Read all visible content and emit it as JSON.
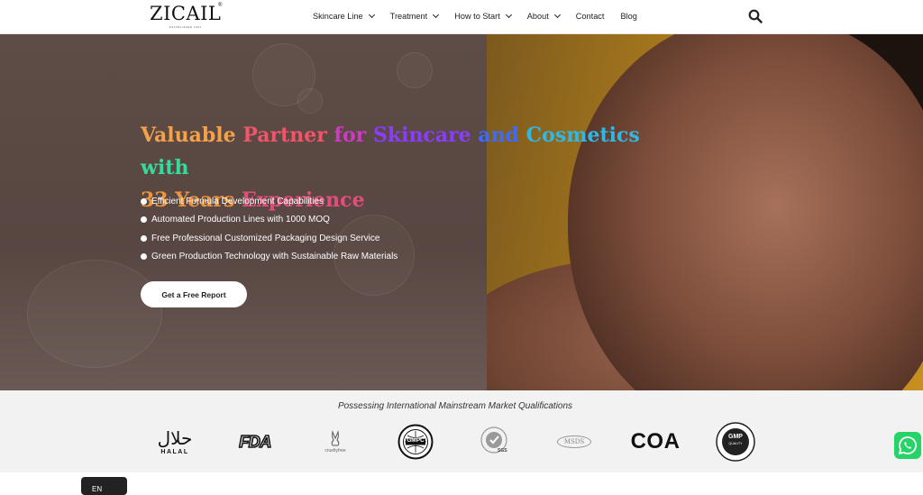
{
  "header": {
    "logo_text": "ZICAIL",
    "logo_sub": "ESTABLISHED 1991",
    "logo_reg": "®",
    "nav": [
      {
        "label": "Skincare Line",
        "dropdown": true
      },
      {
        "label": "Treatment",
        "dropdown": true
      },
      {
        "label": "How to Start",
        "dropdown": true
      },
      {
        "label": "About",
        "dropdown": true
      },
      {
        "label": "Contact",
        "dropdown": false
      },
      {
        "label": "Blog",
        "dropdown": false
      }
    ],
    "search_icon": "search-icon"
  },
  "hero": {
    "headline_words": [
      "Valuable",
      "Partner",
      "for",
      "Skincare",
      "and",
      "Cosmetics",
      "with",
      "33 Years",
      "Experience"
    ],
    "features": [
      "Efficient Formula Development Capabilities",
      "Automated Production Lines with 1000 MOQ",
      "Free Professional Customized Packaging Design Service",
      "Green Production Technology with Sustainable Raw Materials"
    ],
    "cta_label": "Get a Free Report"
  },
  "qualifications": {
    "title": "Possessing International Mainstream Market Qualifications",
    "logos": [
      {
        "name": "halal",
        "text": "حلال",
        "sub": "HALAL"
      },
      {
        "name": "fda",
        "text": "FDA"
      },
      {
        "name": "cruelty-free",
        "text": "crueltyfree"
      },
      {
        "name": "gmpc",
        "text": "GMPC"
      },
      {
        "name": "sgs",
        "text": "SGS"
      },
      {
        "name": "msds",
        "text": "MSDS"
      },
      {
        "name": "coa",
        "text": "COA"
      },
      {
        "name": "gmp",
        "text": "GMP",
        "sub": "QUALITY"
      }
    ]
  },
  "widgets": {
    "language": "EN",
    "whatsapp_icon": "whatsapp-icon"
  },
  "colors": {
    "hero_overlay": "#5c4a44",
    "cta_bg": "#ffffff",
    "whatsapp": "#25d366"
  }
}
